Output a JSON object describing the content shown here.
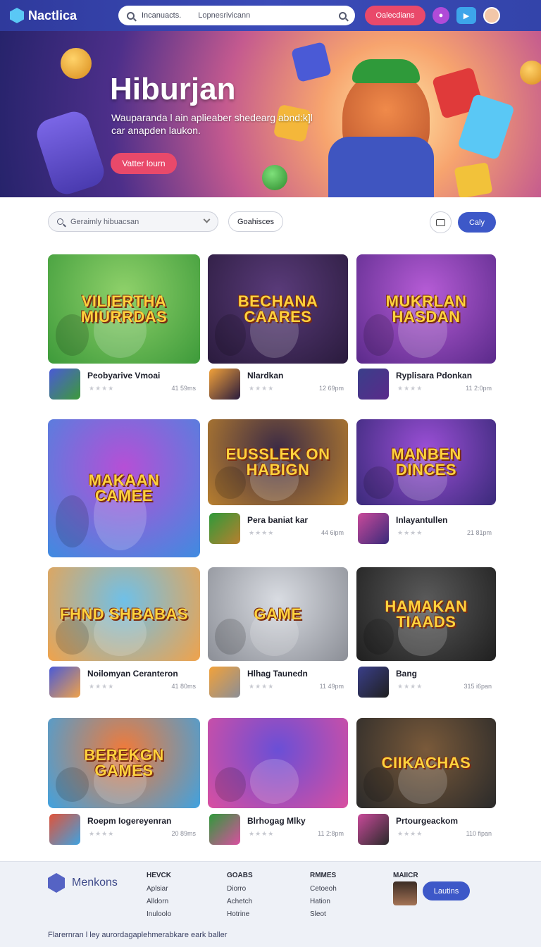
{
  "topbar": {
    "brand": "Nactlica",
    "search_placeholder": "Incanuacts.",
    "search_hint": "Lopnesrivicann",
    "cta": "Oalecdians"
  },
  "hero": {
    "title": "Hiburjan",
    "subtitle": "Wauparanda l ain aplieaber shedearg abnd:k]l car anapden laukon.",
    "button": "Vatter lourn"
  },
  "filters": {
    "dropdown": "Geraimly hibuacsan",
    "chip": "Goahisces",
    "cta": "Caly"
  },
  "rows": [
    {
      "cards": [
        {
          "thumb": "VILIERTHA MIURRDAS",
          "title": "Peobyarive Vmoai",
          "time": "41 59ms",
          "stars": "★★★★",
          "theme": [
            "#8fd16a",
            "#3d9a3a"
          ]
        },
        {
          "thumb": "BECHANA CAARES",
          "title": "Nlardkan",
          "time": "12 69pm",
          "stars": "★★★★",
          "theme": [
            "#5a3b7a",
            "#2a1b3d"
          ]
        },
        {
          "thumb": "MUKRLAN HASDAN",
          "title": "Ryplisara Pdonkan",
          "time": "11 2:0pm",
          "stars": "★★★★",
          "theme": [
            "#b65cd6",
            "#5a2a8a"
          ]
        }
      ]
    },
    {
      "cards": [
        {
          "thumb": "MAKAAN CAMEE",
          "title": "",
          "time": "",
          "stars": "",
          "theme": [
            "#b64fd6",
            "#3f8be0"
          ]
        },
        {
          "thumb": "EUSSLEK ON HABIGN",
          "title": "Pera baniat kar",
          "time": "44 6ipm",
          "stars": "★★★★",
          "theme": [
            "#3b2a45",
            "#b87f2e"
          ]
        },
        {
          "thumb": "MANBEN DINCES",
          "title": "Inlayantullen",
          "time": "21 81pm",
          "stars": "★★★★",
          "theme": [
            "#9b4fd6",
            "#3a2a7a"
          ]
        }
      ]
    },
    {
      "cards": [
        {
          "thumb": "FHND SHBABAS",
          "title": "Noilomyan Ceranteron",
          "time": "41 80ms",
          "stars": "★★★★",
          "theme": [
            "#6fc0e8",
            "#f0a24a"
          ]
        },
        {
          "thumb": "GAME",
          "title": "Hlhag Taunedn",
          "time": "11 49pm",
          "stars": "★★★★",
          "theme": [
            "#d9dce2",
            "#8b8e96"
          ]
        },
        {
          "thumb": "HAMAKAN TIAADS",
          "title": "Bang",
          "time": "315 i6pan",
          "stars": "★★★★",
          "theme": [
            "#5a5a5a",
            "#1f1f1f"
          ]
        }
      ]
    },
    {
      "cards": [
        {
          "thumb": "BEREKGN GAMES",
          "title": "Roepm Iogereyenran",
          "time": "20 89ms",
          "stars": "★★★★",
          "theme": [
            "#f07a3a",
            "#3fa2e0"
          ]
        },
        {
          "thumb": "",
          "title": "Blrhogag Mlky",
          "time": "11 2:8pm",
          "stars": "★★★★",
          "theme": [
            "#6a4fd6",
            "#d94fa0"
          ]
        },
        {
          "thumb": "CIIKACHAS",
          "title": "Prtourgeackom",
          "time": "110 fipan",
          "stars": "★★★★",
          "theme": [
            "#7a5a3a",
            "#2a2a2a"
          ]
        }
      ]
    }
  ],
  "footer": {
    "brand": "Menkons",
    "cols": [
      {
        "heading": "HEVCK",
        "links": [
          "Aplsiar",
          "Alldorn",
          "Inuloolo"
        ]
      },
      {
        "heading": "GOABS",
        "links": [
          "Diorro",
          "Achetch",
          "Hotrine"
        ]
      },
      {
        "heading": "RMMES",
        "links": [
          "Cetoeoh",
          "Hation",
          "Sleot"
        ]
      },
      {
        "heading": "MAIICR",
        "links": []
      }
    ],
    "button": "Lautins",
    "note": "Flarernran l ley aurordagaplehmerabkare eark baller"
  },
  "colors": {
    "accent": "#e9496a",
    "primary": "#3d58c8",
    "topbar": "#3344aa"
  }
}
